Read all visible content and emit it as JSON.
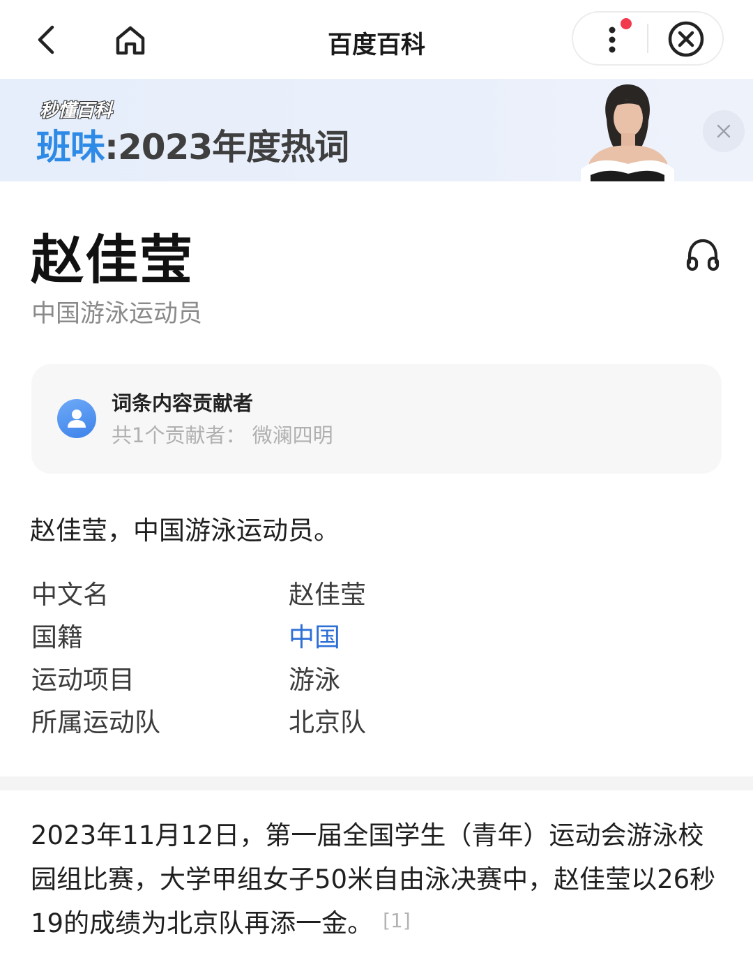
{
  "topbar": {
    "title": "百度百科",
    "icons": {
      "back": "back-chevron-icon",
      "home": "home-icon",
      "more": "more-vertical-icon",
      "close": "close-circle-icon"
    },
    "notification_dot_color": "#f23a4d"
  },
  "banner": {
    "brand": "秒懂百科",
    "highlight": "班味",
    "separator": ":",
    "text": "2023年度热词",
    "highlight_color": "#2d8ae6"
  },
  "entry": {
    "title": "赵佳莹",
    "subtitle": "中国游泳运动员"
  },
  "contributors": {
    "title": "词条内容贡献者",
    "description": "共1个贡献者： 微澜四明"
  },
  "summary": "赵佳莹，中国游泳运动员。",
  "basic_info": [
    {
      "key": "中文名",
      "value": "赵佳莹"
    },
    {
      "key": "国籍",
      "value": "中国"
    },
    {
      "key": "运动项目",
      "value": "游泳"
    },
    {
      "key": "所属运动队",
      "value": "北京队"
    }
  ],
  "news": {
    "text": "2023年11月12日，第一届全国学生（青年）运动会游泳校园组比赛，大学甲组女子50米自由泳决赛中，赵佳莹以26秒19的成绩为北京队再添一金。",
    "citation": "[1]"
  },
  "colors": {
    "link": "#2e6fd6"
  }
}
